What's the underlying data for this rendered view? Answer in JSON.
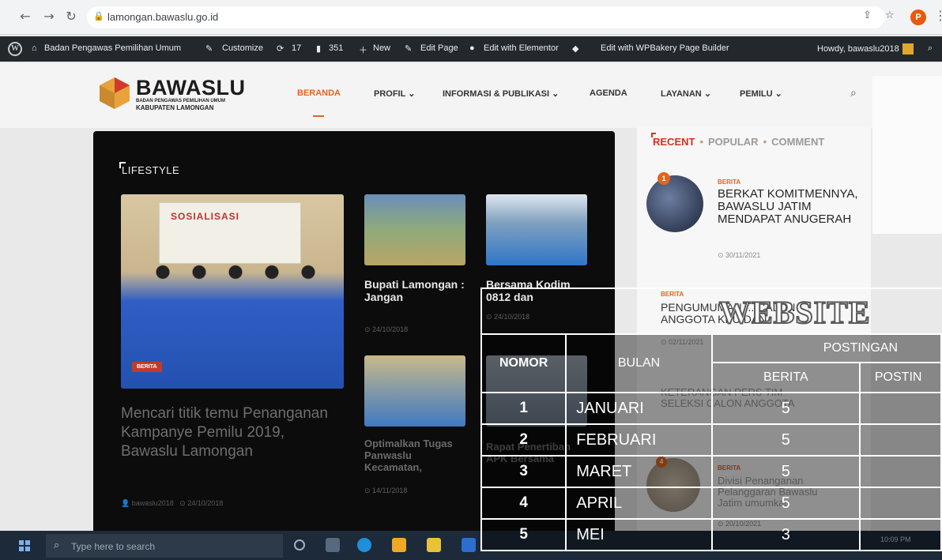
{
  "browser": {
    "url": "lamongan.bawaslu.go.id",
    "profile_initial": "P"
  },
  "adminbar": {
    "site_name": "Badan Pengawas Pemilihan Umum",
    "customize": "Customize",
    "updates": "17",
    "comments": "351",
    "new": "New",
    "edit_page": "Edit Page",
    "elementor": "Edit with Elementor",
    "wpbakery": "Edit with WPBakery Page Builder",
    "howdy": "Howdy, bawaslu2018"
  },
  "header": {
    "logo_name": "BAWASLU",
    "logo_sub": "BADAN PENGAWAS PEMILIHAN UMUM",
    "logo_district": "KABUPATEN LAMONGAN",
    "menu": [
      "BERANDA",
      "PROFIL",
      "INFORMASI & PUBLIKASI",
      "AGENDA",
      "LAYANAN",
      "PEMILU"
    ]
  },
  "lifestyle": {
    "title": "LIFESTYLE",
    "banner_text": "SOSIALISASI",
    "main_tag": "BERITA",
    "main_title": "Mencari titik temu Penanganan Kampanye Pemilu 2019, Bawaslu Lamongan",
    "main_author": "bawaslu2018",
    "main_date": "24/10/2018",
    "card1_title": "Bupati Lamongan : Jangan",
    "card1_date": "24/10/2018",
    "card2_title": "Bersama Kodim 0812 dan",
    "card2_date": "24/10/2018",
    "card3_title": "Optimalkan Tugas Panwaslu Kecamatan,",
    "card3_date": "14/11/2018",
    "card4_title": "Rapat Penertiban APK Bersama",
    "card4_date": "14/11/2018"
  },
  "sidebar": {
    "tab_recent": "RECENT",
    "tab_popular": "POPULAR",
    "tab_comment": "COMMENT",
    "post1_num": "1",
    "post1_cat": "BERITA",
    "post1_title": "BERKAT KOMITMENNYA, BAWASLU JATIM MENDAPAT ANUGERAH",
    "post1_date": "30/11/2021",
    "post2_cat": "BERITA",
    "post2_title": "PENGUMUMAN ... CALON ANGGOTA KPU DAN",
    "post2_date": "02/11/2021",
    "post3_title": "KETERANGAN PERS TIM SELEKSI CALON ANGGOTA",
    "post4_num": "4",
    "post4_cat": "BERITA",
    "post4_title": "Divisi Penanganan Pelanggaran Bawaslu Jatim umumkan",
    "post4_date": "20/10/2021"
  },
  "taskbar": {
    "search_placeholder": "Type here to search",
    "time": "10:09 PM"
  },
  "overlay": {
    "title": "WEBSITE",
    "header_nomor": "NOMOR",
    "header_bulan": "BULAN",
    "header_postingan": "POSTINGAN",
    "header_berita": "BERITA",
    "header_postin": "POSTIN",
    "rows": [
      {
        "no": "1",
        "bulan": "JANUARI",
        "berita": "5"
      },
      {
        "no": "2",
        "bulan": "FEBRUARI",
        "berita": "5"
      },
      {
        "no": "3",
        "bulan": "MARET",
        "berita": "5"
      },
      {
        "no": "4",
        "bulan": "APRIL",
        "berita": "5"
      },
      {
        "no": "5",
        "bulan": "MEI",
        "berita": "3"
      }
    ]
  }
}
